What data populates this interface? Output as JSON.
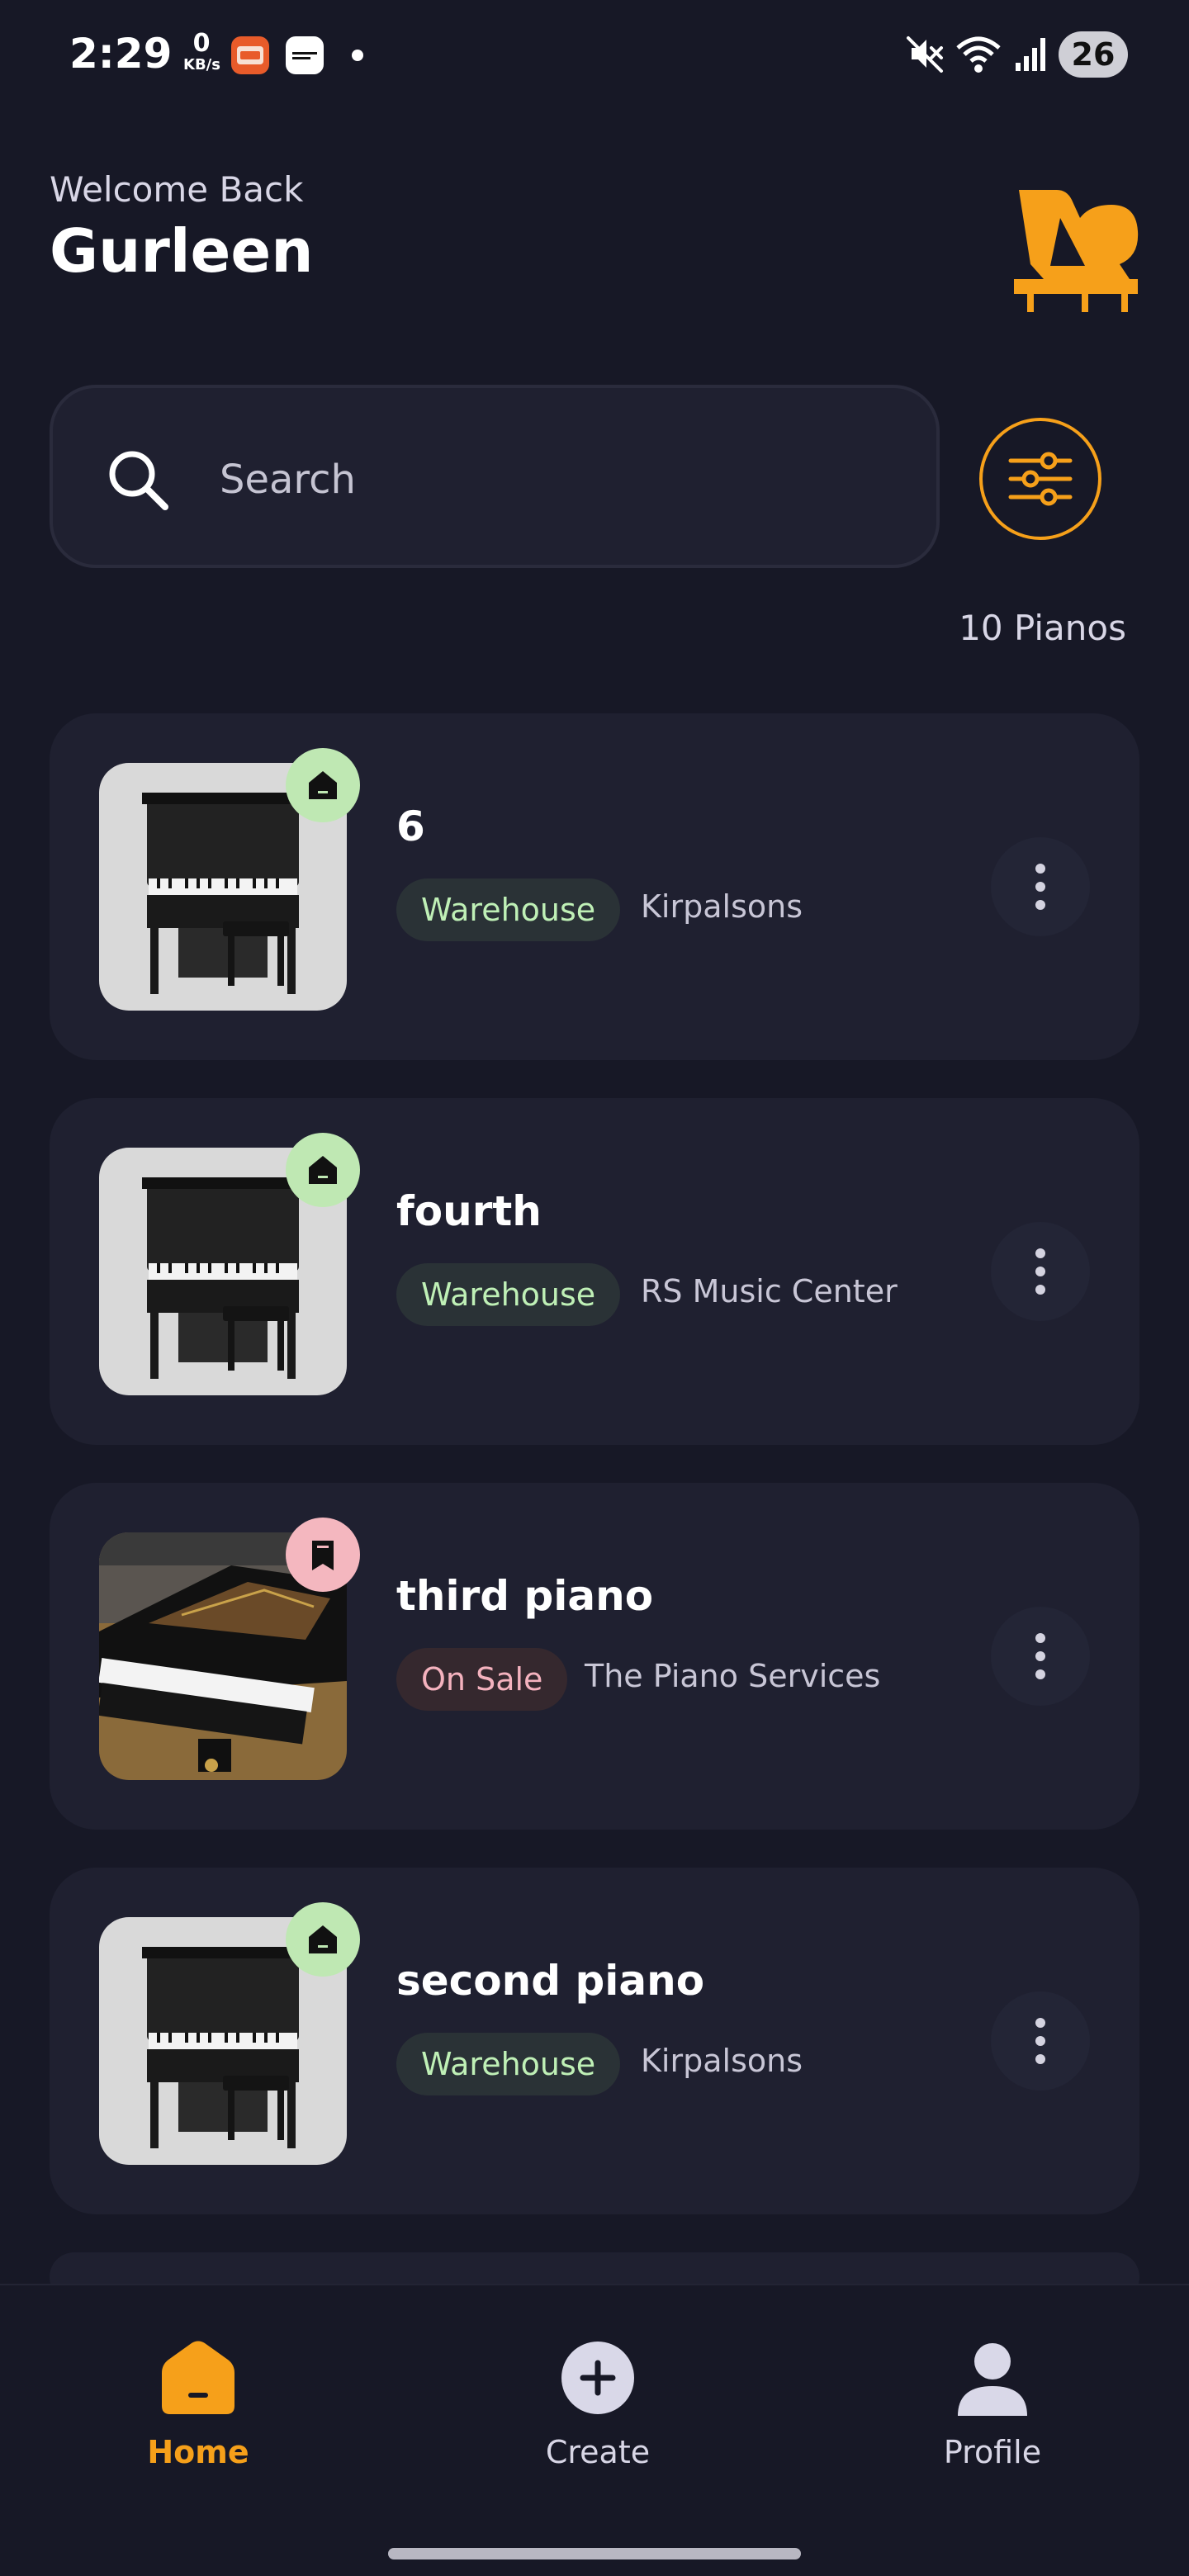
{
  "status_bar": {
    "time": "2:29",
    "net_speed_value": "0",
    "net_speed_unit": "KB/s",
    "battery": "26",
    "icons": [
      "apollo-app-icon",
      "news-app-icon",
      "notification-dot",
      "mute-icon",
      "wifi-icon",
      "signal-icon",
      "battery-icon"
    ]
  },
  "header": {
    "welcome": "Welcome Back",
    "username": "Gurleen",
    "logo": "grand-piano-logo"
  },
  "search": {
    "placeholder": "Search"
  },
  "summary": {
    "count": "10 Pianos"
  },
  "pianos": [
    {
      "name": "6",
      "status": "Warehouse",
      "store": "Kirpalsons",
      "image": "upright-piano",
      "badge": "home-icon"
    },
    {
      "name": "fourth",
      "status": "Warehouse",
      "store": "RS Music Center",
      "image": "upright-piano",
      "badge": "home-icon"
    },
    {
      "name": "third piano",
      "status": "On Sale",
      "store": "The Piano Services",
      "image": "grand-piano",
      "badge": "bookmark-icon"
    },
    {
      "name": "second piano",
      "status": "Warehouse",
      "store": "Kirpalsons",
      "image": "upright-piano",
      "badge": "home-icon"
    }
  ],
  "nav": {
    "home": "Home",
    "create": "Create",
    "profile": "Profile",
    "active": "home"
  },
  "colors": {
    "background": "#171826",
    "card": "#1f2030",
    "accent": "#f6a01a",
    "warehouse_badge": "#bfe8b3",
    "onsale_badge": "#f4b7bf"
  }
}
